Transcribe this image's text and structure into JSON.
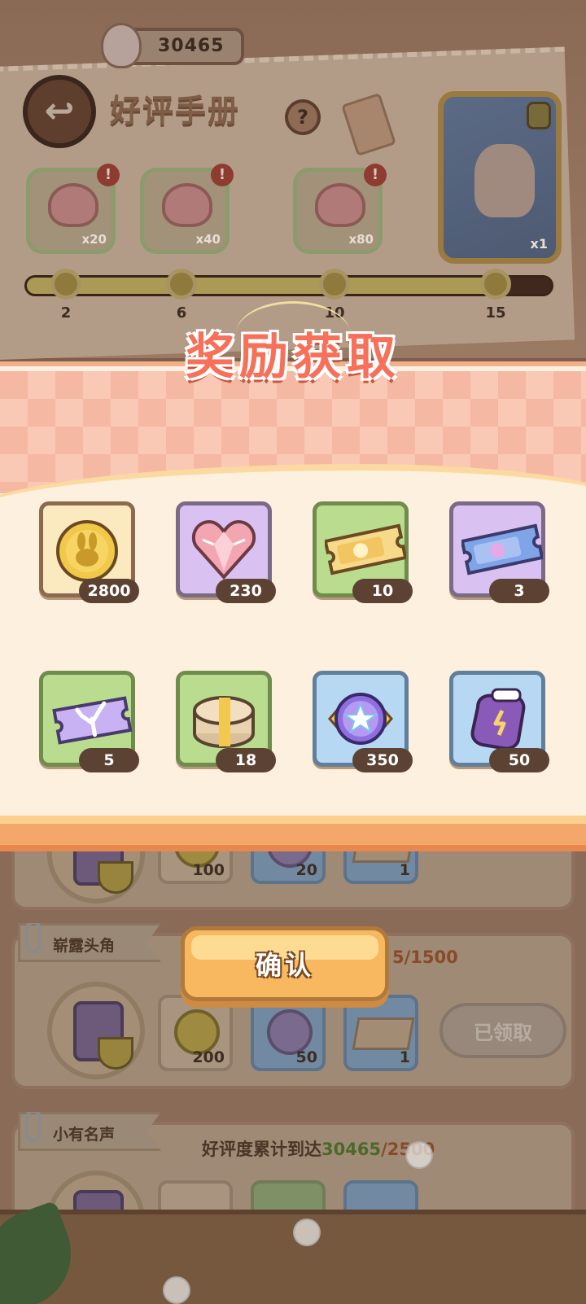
{
  "header": {
    "currency_value": "30465",
    "page_title": "好评手册",
    "help_label": "?",
    "back_label": "↩"
  },
  "milestones": [
    {
      "qty": "x20",
      "alert": "!"
    },
    {
      "qty": "x40",
      "alert": "!"
    },
    {
      "qty": "x80",
      "alert": "!"
    }
  ],
  "grand_reward": {
    "qty": "x1"
  },
  "progress": {
    "fill_fraction": 0.91,
    "nodes": [
      "2",
      "6",
      "10",
      "15"
    ]
  },
  "modal": {
    "title": "奖励获取",
    "confirm_label": "确认",
    "rewards": [
      {
        "item": "bunny-coin-icon",
        "count": "2800"
      },
      {
        "item": "crystal-heart-icon",
        "count": "230"
      },
      {
        "item": "gold-ticket-icon",
        "count": "10"
      },
      {
        "item": "blue-ticket-icon",
        "count": "3"
      },
      {
        "item": "coral-ticket-icon",
        "count": "5"
      },
      {
        "item": "gift-box-icon",
        "count": "18"
      },
      {
        "item": "star-badge-icon",
        "count": "350"
      },
      {
        "item": "purple-glove-icon",
        "count": "50"
      }
    ]
  },
  "tasks": [
    {
      "slots": [
        "100",
        "20",
        "1"
      ]
    },
    {
      "tag": "崭露头角",
      "desc_tail": "5/1500",
      "slots": [
        "200",
        "50",
        "1"
      ],
      "status": "已领取"
    },
    {
      "tag": "小有名声",
      "desc_prefix": "好评度累计到达",
      "desc_value": "30465",
      "desc_target": "/2500"
    }
  ],
  "colors": {
    "title_red": "#f6705a",
    "confirm_orange": "#f7b85f",
    "panel_cream": "#fdf0df"
  }
}
